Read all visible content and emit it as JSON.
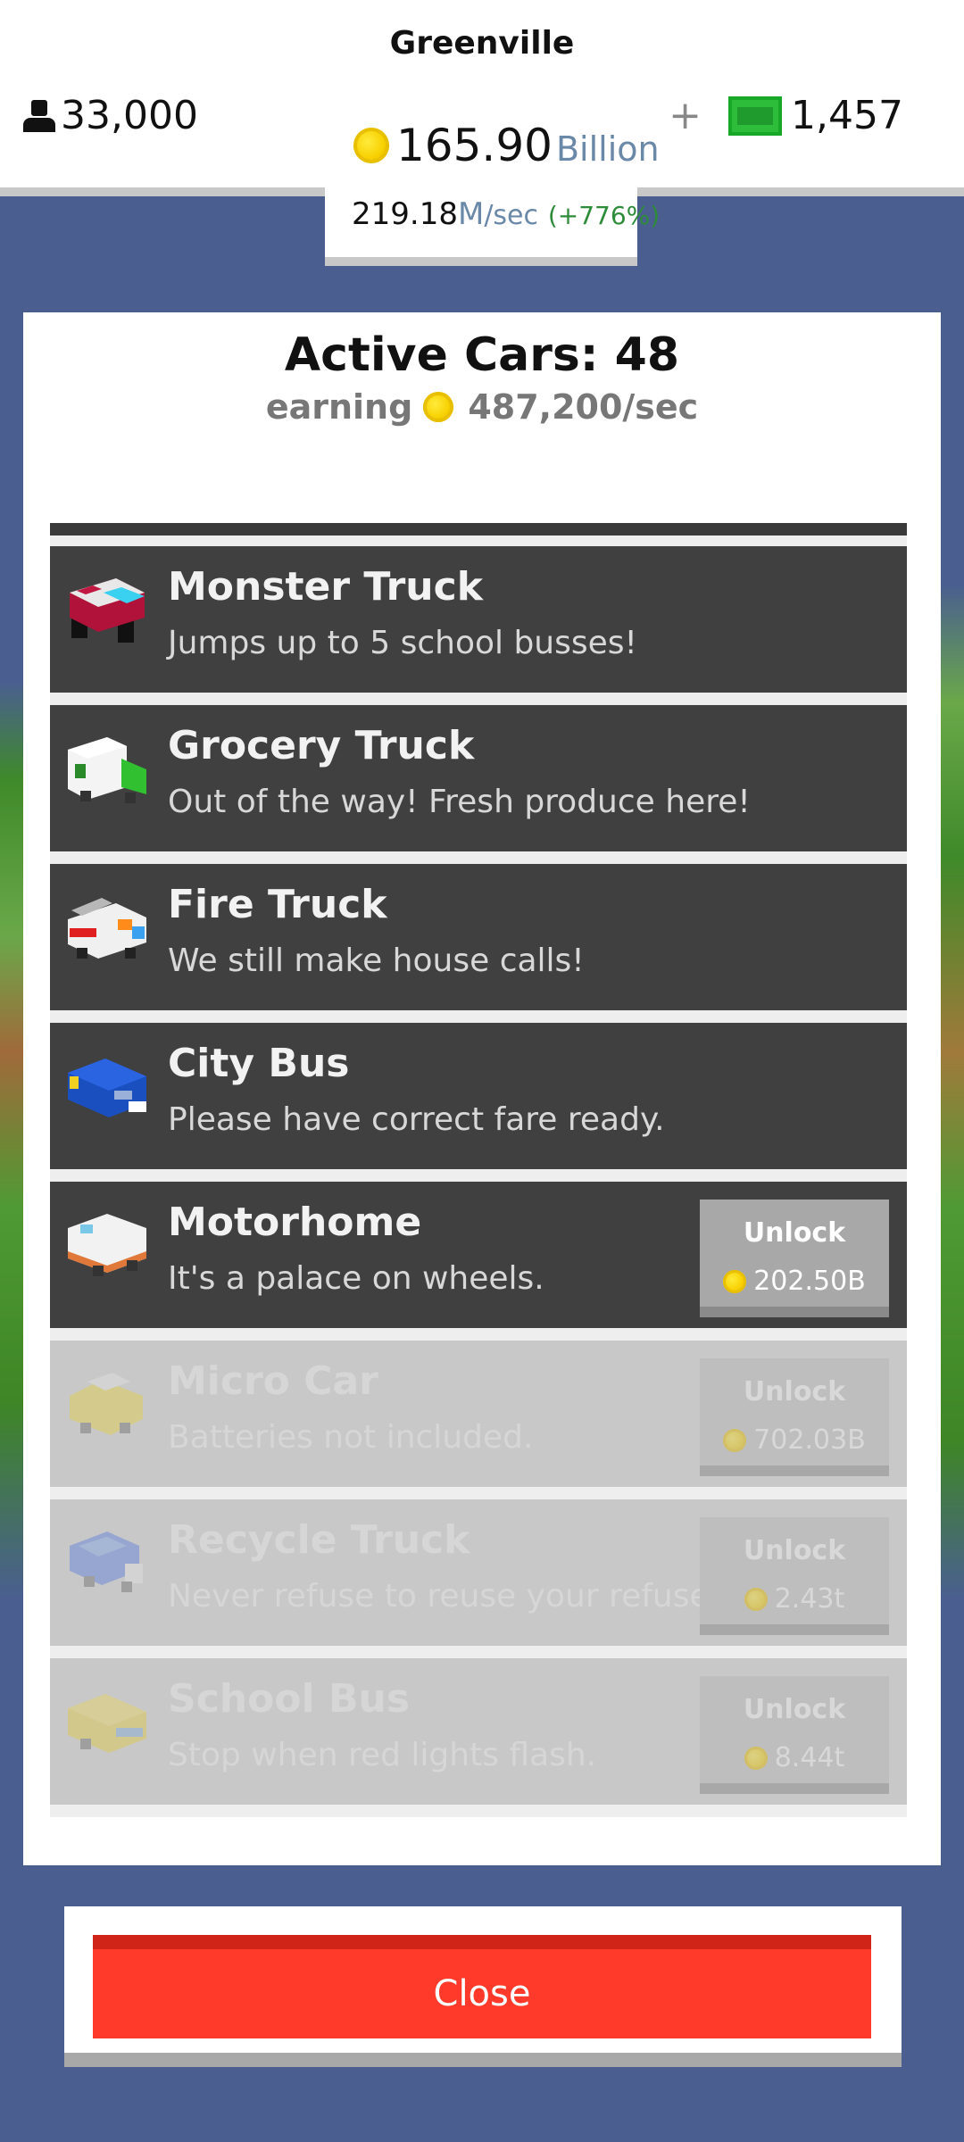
{
  "header": {
    "city": "Greenville",
    "population": "33,000",
    "coins_amount": "165.90",
    "coins_unit": "Billion",
    "rate_value": "219.18",
    "rate_unit_m": "M",
    "rate_unit_sec": "/sec",
    "rate_pct": "(+776%)",
    "plus": "+",
    "cash": "1,457"
  },
  "panel": {
    "title": "Active Cars: 48",
    "earning_label": "earning",
    "earning_value": "487,200/sec"
  },
  "cars": [
    {
      "name": "Monster Truck",
      "desc": "Jumps up to 5 school busses!",
      "icon": "monster-truck-icon"
    },
    {
      "name": "Grocery Truck",
      "desc": "Out of the way! Fresh produce here!",
      "icon": "grocery-truck-icon"
    },
    {
      "name": "Fire Truck",
      "desc": "We still make house calls!",
      "icon": "fire-truck-icon"
    },
    {
      "name": "City Bus",
      "desc": "Please have correct fare ready.",
      "icon": "city-bus-icon"
    },
    {
      "name": "Motorhome",
      "desc": "It's a palace on wheels.",
      "icon": "motorhome-icon",
      "unlock": "Unlock",
      "price": "202.50B"
    },
    {
      "name": "Micro Car",
      "desc": "Batteries not included.",
      "icon": "micro-car-icon",
      "unlock": "Unlock",
      "price": "702.03B"
    },
    {
      "name": "Recycle Truck",
      "desc": "Never refuse to reuse your refuse.",
      "icon": "recycle-truck-icon",
      "unlock": "Unlock",
      "price": "2.43t"
    },
    {
      "name": "School Bus",
      "desc": "Stop when red lights flash.",
      "icon": "school-bus-icon",
      "unlock": "Unlock",
      "price": "8.44t"
    }
  ],
  "close_label": "Close",
  "colors": {
    "background": "#4a5f8f",
    "close_button": "#ff3a2a",
    "row_active": "#404040",
    "row_locked": "#c8c8c8",
    "rate_pct": "#2e8b3a"
  }
}
